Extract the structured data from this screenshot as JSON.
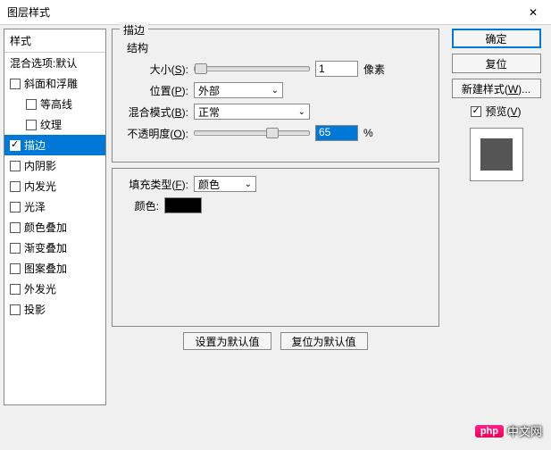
{
  "title": "图层样式",
  "sidebar": {
    "header": "样式",
    "blend_options": "混合选项:默认",
    "items": [
      {
        "label": "斜面和浮雕",
        "checked": false,
        "selected": false,
        "indent": false
      },
      {
        "label": "等高线",
        "checked": false,
        "selected": false,
        "indent": true
      },
      {
        "label": "纹理",
        "checked": false,
        "selected": false,
        "indent": true
      },
      {
        "label": "描边",
        "checked": true,
        "selected": true,
        "indent": false
      },
      {
        "label": "内阴影",
        "checked": false,
        "selected": false,
        "indent": false
      },
      {
        "label": "内发光",
        "checked": false,
        "selected": false,
        "indent": false
      },
      {
        "label": "光泽",
        "checked": false,
        "selected": false,
        "indent": false
      },
      {
        "label": "颜色叠加",
        "checked": false,
        "selected": false,
        "indent": false
      },
      {
        "label": "渐变叠加",
        "checked": false,
        "selected": false,
        "indent": false
      },
      {
        "label": "图案叠加",
        "checked": false,
        "selected": false,
        "indent": false
      },
      {
        "label": "外发光",
        "checked": false,
        "selected": false,
        "indent": false
      },
      {
        "label": "投影",
        "checked": false,
        "selected": false,
        "indent": false
      }
    ]
  },
  "stroke": {
    "group_label": "描边",
    "structure_label": "结构",
    "size_label": "大小(S):",
    "size_value": "1",
    "size_unit": "像素",
    "position_label": "位置(P):",
    "position_value": "外部",
    "blend_label": "混合模式(B):",
    "blend_value": "正常",
    "opacity_label": "不透明度(O):",
    "opacity_value": "65",
    "opacity_unit": "%",
    "fill_label": "填充类型(F):",
    "fill_value": "颜色",
    "color_label": "颜色:",
    "default_btn": "设置为默认值",
    "reset_btn": "复位为默认值"
  },
  "right": {
    "ok": "确定",
    "cancel": "复位",
    "new_style": "新建样式(W)...",
    "preview": "预览(V)"
  },
  "watermark": {
    "badge": "php",
    "text": "中文网"
  }
}
